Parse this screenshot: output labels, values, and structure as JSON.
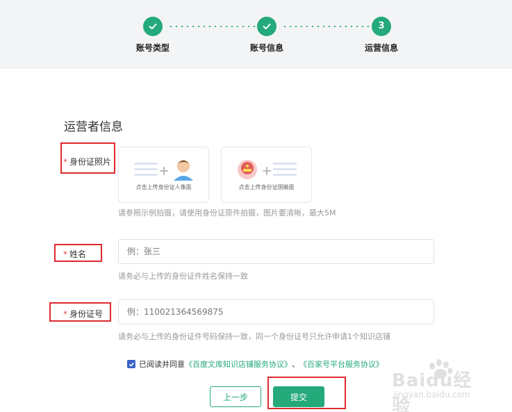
{
  "stepper": {
    "steps": [
      {
        "label": "账号类型",
        "state": "done"
      },
      {
        "label": "账号信息",
        "state": "done"
      },
      {
        "label": "运营信息",
        "state": "current",
        "number": "3"
      }
    ],
    "accent": "#24a97b"
  },
  "section": {
    "title": "运营者信息"
  },
  "id_photo": {
    "label": "身份证照片",
    "front_caption": "点击上传身份证人像面",
    "back_caption": "点击上传身份证国徽面",
    "hint": "请参照示例拍摄，请使用身份证原件拍摄，图片要清晰，最大5M"
  },
  "name": {
    "label": "姓名",
    "placeholder": "例：张三",
    "hint": "请务必与上传的身份证件姓名保持一致"
  },
  "id_number": {
    "label": "身份证号",
    "placeholder": "例：110021364569875",
    "hint": "请务必与上传的身份证件号码保持一致，同一个身份证号只允许申请1个知识店铺"
  },
  "agreement": {
    "checked": true,
    "prefix": "已阅读并同意",
    "link1": "《百度文库知识店铺服务协议》",
    "separator": "、",
    "link2": "《百家号平台服务协议》"
  },
  "buttons": {
    "prev": "上一步",
    "submit": "提交"
  },
  "watermark": {
    "brand": "Baidu经验",
    "url": "jingyan.baidu.com"
  }
}
